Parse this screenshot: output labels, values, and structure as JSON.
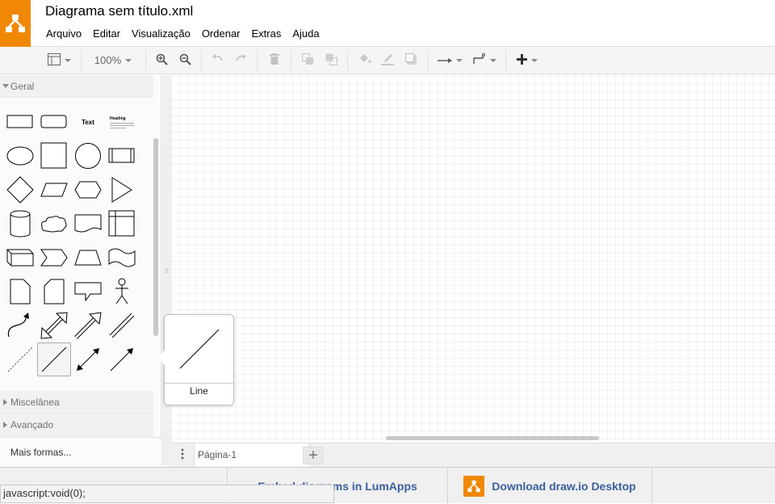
{
  "app": {
    "title": "Diagrama sem título.xml",
    "accent_color": "#f08705",
    "logo_icon": "drawio-logo-icon"
  },
  "menu": [
    "Arquivo",
    "Editar",
    "Visualização",
    "Ordenar",
    "Extras",
    "Ajuda"
  ],
  "toolbar": {
    "zoom": "100%",
    "buttons": [
      "format-panel-icon",
      "zoom-in-icon",
      "zoom-out-icon",
      "undo-icon",
      "redo-icon",
      "delete-icon",
      "to-front-icon",
      "to-back-icon",
      "fill-color-icon",
      "line-color-icon",
      "shadow-icon",
      "connection-icon",
      "waypoints-icon",
      "insert-plus-icon"
    ]
  },
  "sidebar": {
    "sections": [
      {
        "label": "Geral",
        "expanded": true
      },
      {
        "label": "Miscelânea",
        "expanded": false
      },
      {
        "label": "Avançado",
        "expanded": false
      }
    ],
    "general_text_shape": "Text",
    "heading_shape": "Heading",
    "more_shapes": "Mais formas..."
  },
  "tooltip": {
    "label": "Line"
  },
  "pages": {
    "current": "Página-1"
  },
  "footer": {
    "embed_link": "Embed diagrams in LumApps",
    "download_link": "Download draw.io Desktop"
  },
  "status_text": "javascript:void(0);"
}
